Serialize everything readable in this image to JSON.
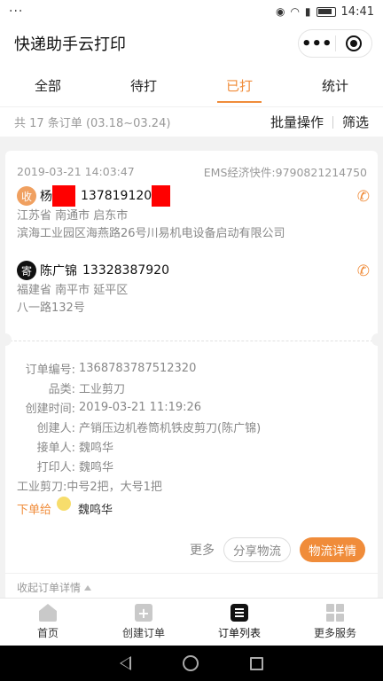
{
  "status_bar": {
    "left": "···",
    "time": "14:41"
  },
  "header": {
    "title": "快递助手云打印"
  },
  "tabs": [
    {
      "label": "全部",
      "active": false
    },
    {
      "label": "待打",
      "active": false
    },
    {
      "label": "已打",
      "active": true
    },
    {
      "label": "统计",
      "active": false
    }
  ],
  "summary": {
    "count_text": "共 17 条订单 (03.18~03.24)",
    "batch_label": "批量操作",
    "filter_label": "筛选"
  },
  "order": {
    "date": "2019-03-21 14:03:47",
    "tracking": "EMS经济快件:9790821214750",
    "receiver": {
      "badge": "收",
      "name": "杨",
      "phone": "137819120",
      "address_line1": "江苏省 南通市 启东市",
      "address_line2": "滨海工业园区海燕路26号川易机电设备启动有限公司"
    },
    "sender": {
      "badge": "寄",
      "name": "陈广锦",
      "phone": "13328387920",
      "address_line1": "福建省 南平市 延平区",
      "address_line2": "八一路132号"
    },
    "details": {
      "order_no_label": "订单编号:",
      "order_no": "1368783787512320",
      "category_label": "品类:",
      "category": "工业剪刀",
      "created_time_label": "创建时间:",
      "created_time": "2019-03-21 11:19:26",
      "creator_label": "创建人:",
      "creator": "产销压边机卷筒机铁皮剪刀(陈广锦)",
      "receiver_user_label": "接单人:",
      "receiver_user": "魏鸣华",
      "printer_label": "打印人:",
      "printer": "魏鸣华",
      "items_text": "工业剪刀:中号2把，大号1把"
    },
    "assign_label": "下单给",
    "assign_to": "魏鸣华",
    "more_label": "更多",
    "share_label": "分享物流",
    "logistics_label": "物流详情",
    "collapse_label": "收起订单详情"
  },
  "bottom_nav": [
    {
      "label": "首页",
      "icon": "home-icon"
    },
    {
      "label": "创建订单",
      "icon": "plus-icon"
    },
    {
      "label": "订单列表",
      "icon": "list-icon",
      "active": true
    },
    {
      "label": "更多服务",
      "icon": "grid-icon"
    }
  ],
  "colors": {
    "accent": "#f08c3a",
    "redaction": "#ff0000"
  }
}
